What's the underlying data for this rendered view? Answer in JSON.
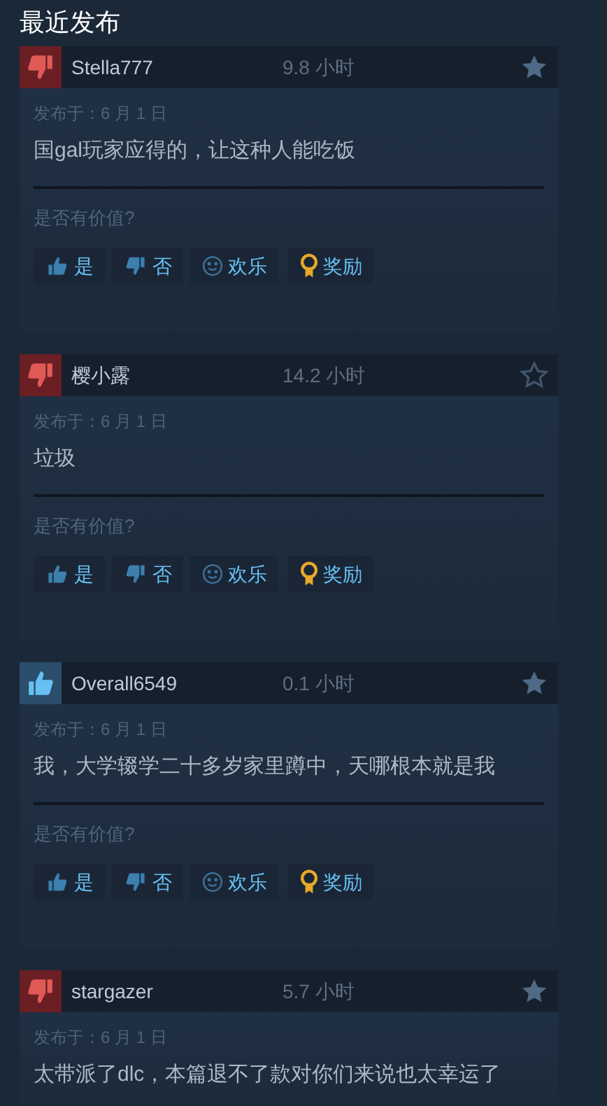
{
  "heading": "最近发布",
  "reviews": [
    {
      "recommended": false,
      "author": "Stella777",
      "hours": "9.8 小时",
      "starred": true,
      "date": "发布于：6 月 1 日",
      "text": "国gal玩家应得的，让这种人能吃饭",
      "prompt": "是否有价值?",
      "buttons": [
        {
          "kind": "yes",
          "label": "是"
        },
        {
          "kind": "no",
          "label": "否"
        },
        {
          "kind": "funny",
          "label": "欢乐"
        },
        {
          "kind": "award",
          "label": "奖励"
        }
      ]
    },
    {
      "recommended": false,
      "author": "樱小露",
      "hours": "14.2 小时",
      "starred": false,
      "date": "发布于：6 月 1 日",
      "text": "垃圾",
      "prompt": "是否有价值?",
      "buttons": [
        {
          "kind": "yes",
          "label": "是"
        },
        {
          "kind": "no",
          "label": "否"
        },
        {
          "kind": "funny",
          "label": "欢乐"
        },
        {
          "kind": "award",
          "label": "奖励"
        }
      ]
    },
    {
      "recommended": true,
      "author": "Overall6549",
      "hours": "0.1 小时",
      "starred": true,
      "date": "发布于：6 月 1 日",
      "text": "我，大学辍学二十多岁家里蹲中，天哪根本就是我",
      "prompt": "是否有价值?",
      "buttons": [
        {
          "kind": "yes",
          "label": "是"
        },
        {
          "kind": "no",
          "label": "否"
        },
        {
          "kind": "funny",
          "label": "欢乐"
        },
        {
          "kind": "award",
          "label": "奖励"
        }
      ]
    },
    {
      "recommended": false,
      "author": "stargazer",
      "hours": "5.7 小时",
      "starred": true,
      "date": "发布于：6 月 1 日",
      "text": "太带派了dlc，本篇退不了款对你们来说也太幸运了"
    }
  ]
}
